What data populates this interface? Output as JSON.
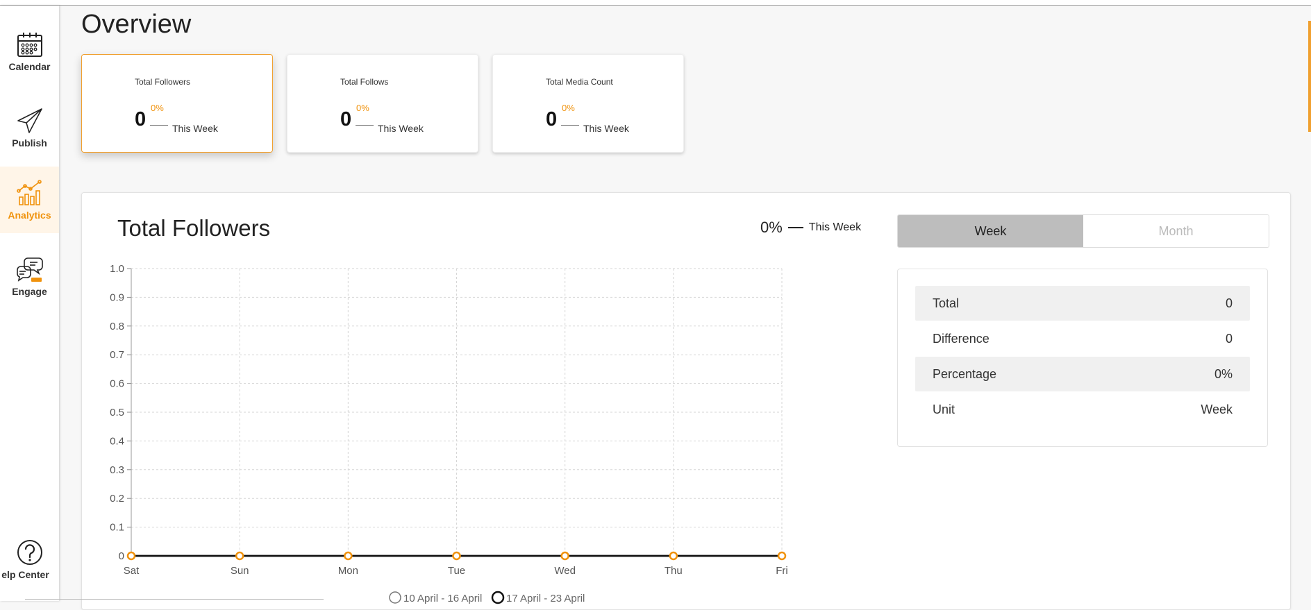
{
  "sidebar": {
    "items": [
      {
        "label": "Calendar",
        "icon": "calendar-icon"
      },
      {
        "label": "Publish",
        "icon": "paper-plane-icon"
      },
      {
        "label": "Analytics",
        "icon": "analytics-chart-icon"
      },
      {
        "label": "Engage",
        "icon": "chat-bubbles-icon"
      },
      {
        "label": "elp Center",
        "icon": "question-circle-icon"
      }
    ],
    "active": "Analytics"
  },
  "page": {
    "title": "Overview"
  },
  "cards": [
    {
      "name": "Total Followers",
      "value": "0",
      "percent": "0%",
      "period": "This Week"
    },
    {
      "name": "Total Follows",
      "value": "0",
      "percent": "0%",
      "period": "This Week"
    },
    {
      "name": "Total Media Count",
      "value": "0",
      "percent": "0%",
      "period": "This Week"
    }
  ],
  "panel": {
    "title": "Total Followers",
    "summary": {
      "percent": "0%",
      "period": "This Week"
    },
    "toggle": {
      "week": "Week",
      "month": "Month",
      "selected": "Week"
    },
    "stats": [
      {
        "label": "Total",
        "value": "0"
      },
      {
        "label": "Difference",
        "value": "0"
      },
      {
        "label": "Percentage",
        "value": "0%"
      },
      {
        "label": "Unit",
        "value": "Week"
      }
    ]
  },
  "colors": {
    "accent": "#f0920c",
    "line": "#111111"
  },
  "chart_data": {
    "type": "line",
    "categories": [
      "Sat",
      "Sun",
      "Mon",
      "Tue",
      "Wed",
      "Thu",
      "Fri"
    ],
    "y_ticks": [
      "1.0",
      "0.9",
      "0.8",
      "0.7",
      "0.6",
      "0.5",
      "0.4",
      "0.3",
      "0.2",
      "0.1",
      "0"
    ],
    "ylim": [
      0,
      1
    ],
    "grid": true,
    "legend": "bottom",
    "series": [
      {
        "name": "10 April - 16 April",
        "values": [
          0,
          0,
          0,
          0,
          0,
          0,
          0
        ]
      },
      {
        "name": "17 April - 23 April",
        "values": [
          0,
          0,
          0,
          0,
          0,
          0,
          0
        ]
      }
    ]
  }
}
